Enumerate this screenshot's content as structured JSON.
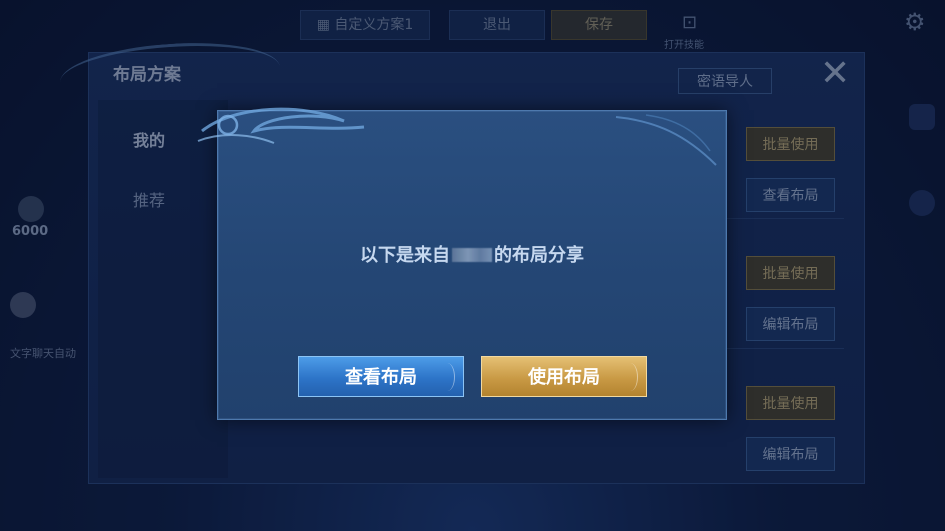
{
  "topbar": {
    "custom_plan_label": "自定义方案1",
    "exit_label": "退出",
    "save_label": "保存",
    "small_label": "打开技能"
  },
  "hud": {
    "gold_amount": "6000",
    "chat_text": "文字聊天自动"
  },
  "layout_panel": {
    "title": "布局方案",
    "passphrase_import_label": "密语导人",
    "side_tabs": [
      {
        "label": "我的"
      },
      {
        "label": "推荐"
      }
    ],
    "groups": [
      {
        "primary_label": "批量使用",
        "secondary_label": "查看布局"
      },
      {
        "primary_label": "批量使用",
        "secondary_label": "编辑布局"
      },
      {
        "primary_label": "批量使用",
        "secondary_label": "编辑布局"
      }
    ]
  },
  "dialog": {
    "message_prefix": "以下是来自",
    "message_suffix": "的布局分享",
    "view_layout_label": "查看布局",
    "use_layout_label": "使用布局"
  },
  "colors": {
    "accent_blue": "#2d74c8",
    "accent_gold": "#c99a45",
    "dialog_bg": "#264a79"
  }
}
